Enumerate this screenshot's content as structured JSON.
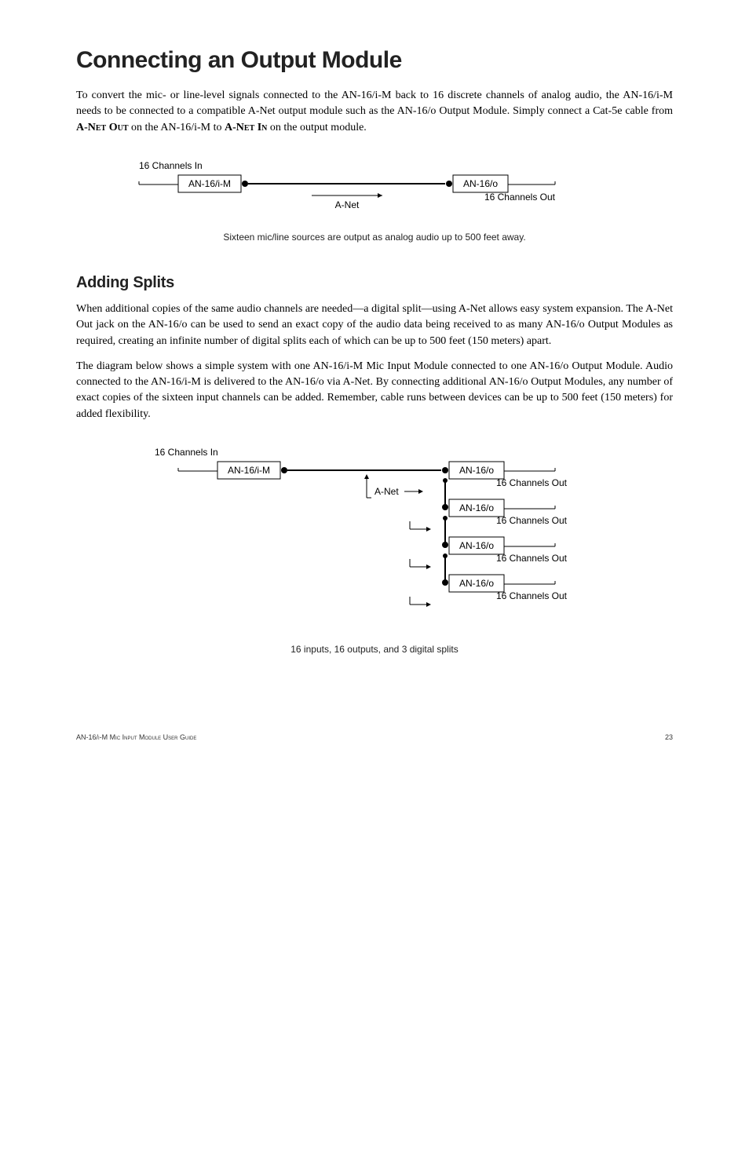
{
  "h1": "Connecting an Output Module",
  "p1_a": "To convert the mic- or line-level signals connected to the AN-16/i-M back to 16 discrete channels of analog audio, the AN-16/i-M needs to be connected to a compatible A-Net output module such as the AN-16/o Output Module. Simply connect a Cat-5e cable from ",
  "p1_b": "A-Net Out",
  "p1_c": " on the AN-16/i-M to ",
  "p1_d": "A-Net In",
  "p1_e": " on the output module.",
  "diagram1": {
    "ch_in": "16 Channels In",
    "box_left": "AN-16/i-M",
    "box_right": "AN-16/o",
    "anet": "A-Net",
    "ch_out": "16 Channels Out"
  },
  "caption1": "Sixteen mic/line sources are output as analog audio up to 500 feet away.",
  "h2": "Adding Splits",
  "p2": "When additional copies of the same audio channels are needed—a digital split—using A-Net allows easy system expansion. The A-Net Out jack on the AN-16/o can be used to send an exact copy of the audio data being received to as many AN-16/o Output Modules as required, creating an infinite number of digital splits each of which can be up to 500 feet (150 meters) apart.",
  "p3": "The diagram below shows a simple system with one AN-16/i-M Mic Input Module connected to one AN-16/o Output Module. Audio connected to the AN-16/i-M is delivered to the AN-16/o via A-Net. By connecting additional AN-16/o Output Modules, any number of exact copies of the sixteen input channels can be added. Remember, cable runs between devices can be up to 500 feet (150 meters) for added flexibility.",
  "diagram2": {
    "ch_in": "16 Channels In",
    "box_left": "AN-16/i-M",
    "box_right": "AN-16/o",
    "anet": "A-Net",
    "ch_out": "16 Channels Out"
  },
  "caption2": "16 inputs, 16 outputs, and 3 digital splits",
  "footer_left": "AN-16/i-M Mic Input Module User Guide",
  "footer_right": "23"
}
